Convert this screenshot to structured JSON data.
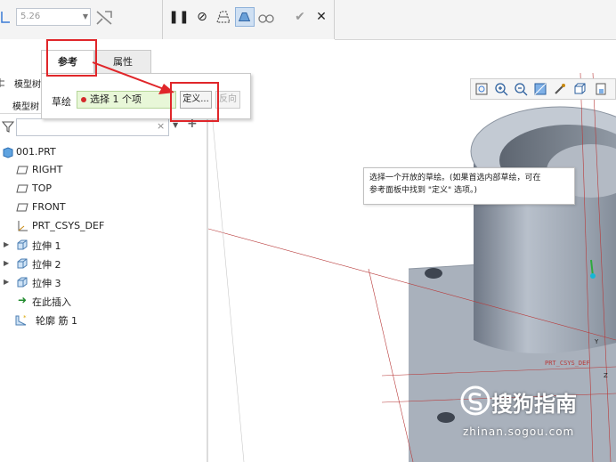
{
  "ribbon": {
    "thickness_value": "5.26",
    "thickness_arrow": "▼",
    "pause_glyph": "❚❚",
    "cancel_feature_glyph": "⊘",
    "confirm_glyph": "✔",
    "close_glyph": "✕"
  },
  "tabs": {
    "ref_label": "参考",
    "prop_label": "属性"
  },
  "ref_panel": {
    "sketch_label": "草绘",
    "collector_value": "选择 1 个项",
    "define_label": "定义...",
    "reverse_label": "反向"
  },
  "model_tree": {
    "title": "模型树",
    "subtitle": "模型树",
    "search_clear": "×",
    "search_dropdown": "▼",
    "add_glyph": "+",
    "items": [
      {
        "label": "001.PRT"
      },
      {
        "label": "RIGHT"
      },
      {
        "label": "TOP"
      },
      {
        "label": "FRONT"
      },
      {
        "label": "PRT_CSYS_DEF"
      },
      {
        "label": "拉伸 1"
      },
      {
        "label": "拉伸 2"
      },
      {
        "label": "拉伸 3"
      },
      {
        "label": "在此插入"
      },
      {
        "label": "轮廓 筋 1"
      }
    ]
  },
  "viewport": {
    "tooltip_line1": "选择一个开放的草绘。(如果首选内部草绘，可在",
    "tooltip_line2": "参考面板中找到 \"定义\" 选项。)",
    "csys_label": "PRT_CSYS_DEF",
    "axis_y": "Y",
    "axis_z": "Z"
  },
  "watermark": {
    "text": "搜狗指南",
    "url": "zhinan.sogou.com"
  },
  "colors": {
    "highlight_red": "#e0262a",
    "collector_bg": "#e8f7d8",
    "model_gray": "#a7afba",
    "datum_red": "#b83a3a"
  }
}
